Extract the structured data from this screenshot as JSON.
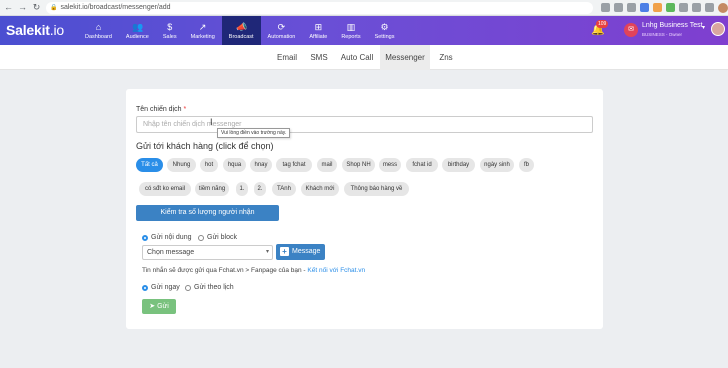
{
  "browser": {
    "url": "salekit.io/broadcast/messenger/add"
  },
  "header": {
    "logo": "Salekit",
    "logo_suffix": ".io",
    "nav": [
      {
        "label": "Dashboard",
        "icon": "house-icon"
      },
      {
        "label": "Audience",
        "icon": "users-icon"
      },
      {
        "label": "Sales",
        "icon": "dollar-icon"
      },
      {
        "label": "Marketing",
        "icon": "chart-icon"
      },
      {
        "label": "Broadcast",
        "icon": "megaphone-icon",
        "active": true
      },
      {
        "label": "Automation",
        "icon": "refresh-icon"
      },
      {
        "label": "Affiliate",
        "icon": "sitemap-icon"
      },
      {
        "label": "Reports",
        "icon": "bar-chart-icon"
      },
      {
        "label": "Settings",
        "icon": "gear-icon"
      }
    ],
    "notification_count": "109",
    "account_name": "Lnhg Business Test",
    "account_plan": "BUSINESS",
    "account_role": "- Owner"
  },
  "tabs": [
    "Email",
    "SMS",
    "Auto Call",
    "Messenger",
    "Zns"
  ],
  "active_tab": "Messenger",
  "form": {
    "campaign_label": "Tên chiến dịch",
    "required_mark": "*",
    "campaign_placeholder": "Nhập tên chiến dịch messenger",
    "tooltip": "Vui lòng điền vào trường này.",
    "send_to_title": "Gửi tới khách hàng (click để chọn)",
    "tags_row1": [
      "Tất cả",
      "Nhung",
      "hot",
      "hqua",
      "hnay",
      "tag fchat",
      "mail",
      "Shop NH",
      "mess",
      "fchat id",
      "birthday",
      "ngày sinh",
      "fb"
    ],
    "tags_row2": [
      "có sđt ko email",
      "tiềm năng",
      "1.",
      "2.",
      "TAnh",
      "Khách mới",
      "Thông báo hàng về"
    ],
    "active_tag": "Tất cả",
    "check_button": "Kiểm tra số lượng người nhận",
    "radio_content": "Gửi nội dung",
    "radio_block": "Gửi block",
    "select_message": "Chọn message",
    "message_button": "Message",
    "info_text": "Tin nhắn sẽ được gửi qua Fchat.vn > Fanpage của bạn - ",
    "info_link": "Kết nối với Fchat.vn",
    "radio_now": "Gửi ngay",
    "radio_schedule": "Gửi theo lịch",
    "send_button": "Gửi"
  }
}
